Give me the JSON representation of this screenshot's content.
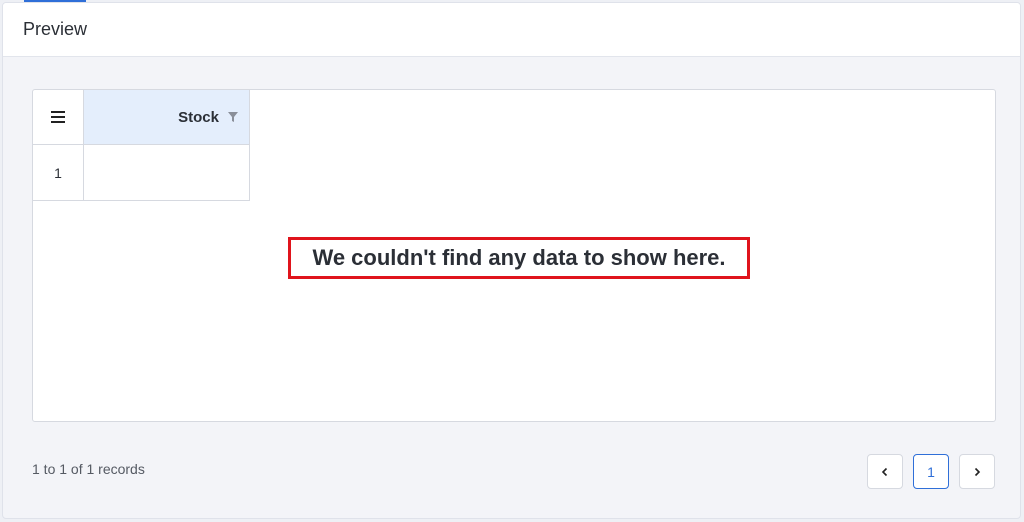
{
  "panel": {
    "title": "Preview"
  },
  "grid": {
    "columns": [
      {
        "label": "Stock",
        "filter_icon": "filter-icon"
      }
    ],
    "rows": [
      {
        "row_number": "1",
        "cells": [
          ""
        ]
      }
    ],
    "empty_message": "We couldn't find any data to show here."
  },
  "pagination": {
    "records_info": "1 to 1 of 1 records",
    "prev_icon": "chevron-left-icon",
    "next_icon": "chevron-right-icon",
    "pages": [
      "1"
    ],
    "current_page": "1"
  },
  "colors": {
    "accent": "#2f6fd8",
    "header_bg": "#e4eefc",
    "highlight_border": "#e0141c"
  }
}
